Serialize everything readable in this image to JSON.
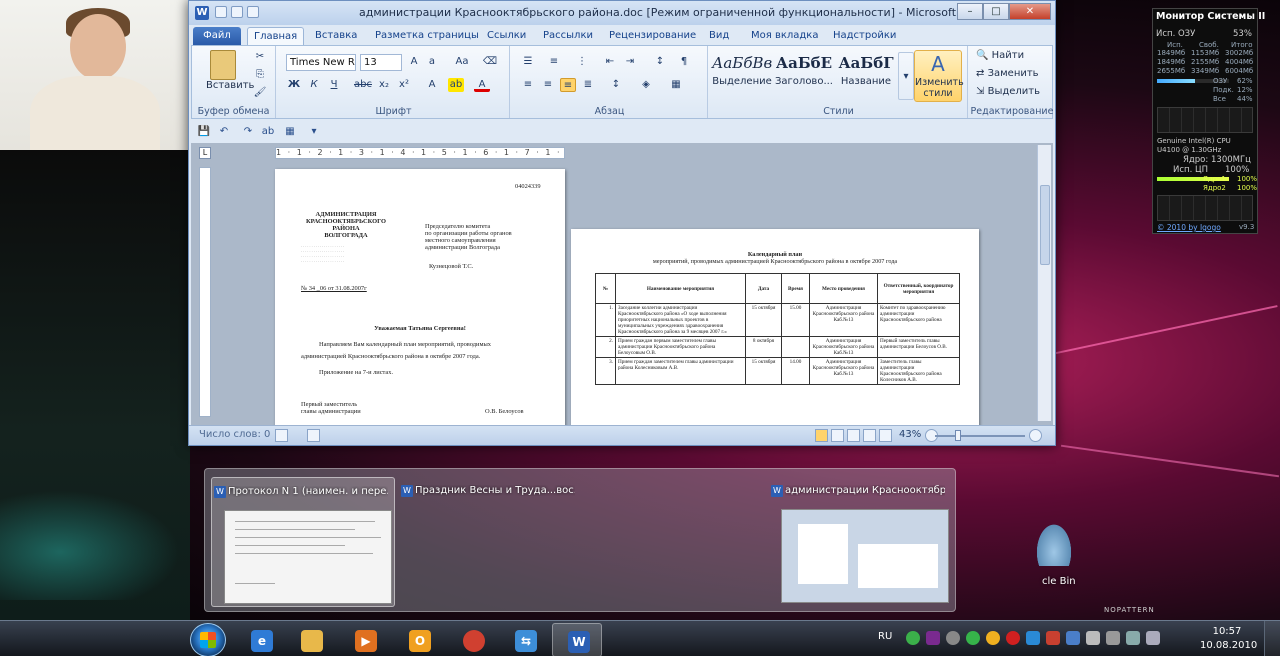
{
  "word": {
    "title": "администрации Красноoктябрьского района.doc [Режим ограниченной функциональности] - Microsoft Word",
    "tabs": [
      "Файл",
      "Главная",
      "Вставка",
      "Разметка страницы",
      "Ссылки",
      "Рассылки",
      "Рецензирование",
      "Вид",
      "Моя вкладка",
      "Надстройки"
    ],
    "ribbon": {
      "paste_label": "Вставить",
      "clipboard_group": "Буфер обмена",
      "font_group": "Шрифт",
      "paragraph_group": "Абзац",
      "styles_group": "Стили",
      "editing_group": "Редактирование",
      "font_name": "Times New Rc",
      "font_size": "13",
      "styles": [
        {
          "sample": "АаБбВв",
          "name": "Выделение"
        },
        {
          "sample": "АаБбЕ",
          "name": "Заголово..."
        },
        {
          "sample": "АаБбГ",
          "name": "Название"
        }
      ],
      "change_styles": "Изменить стили",
      "find": "Найти",
      "replace": "Заменить",
      "select": "Выделить"
    },
    "status": {
      "word_count": "Число слов: 0",
      "zoom": "43%"
    },
    "ruler_marks": "1 · 1 · 2 · 1 · 3 · 1 · 4 · 1 · 5 · 1 · 6 · 1 · 7 · 1 · 8 · 1 · 9 · 1 ·10· 1 ·11· 1 ·12· 1 ·13· 1 ·14· 1 ·15· 1 ·16· 1 ·17· 1 ·18·",
    "page1": {
      "doc_number": "04024339",
      "org": [
        "АДМИНИСТРАЦИЯ",
        "КРАСНООКТЯБРЬСКОГО",
        "РАЙОНА",
        "ВОЛГОГРАДА"
      ],
      "addressee": [
        "Председателю комитета",
        "по организации работы органов",
        "местного самоуправления",
        "администрации Волгограда"
      ],
      "addressee_name": "Кузнецовой Т.С.",
      "out_number": "№ 34 _06 от 31.08.2007г",
      "greeting": "Уважаемая Татьяна Сергеевна!",
      "body1": "Направляем Вам календарный план мероприятий, проводимых",
      "body2": "администрацией Краснооктябрьского района в октябре 2007 года.",
      "attachment": "Приложение на 7-и листах.",
      "signer1": "Первый заместитель",
      "signer2": "главы администрации",
      "signer_name": "О.В. Белоусов"
    },
    "page2": {
      "title": "Календарный план",
      "subtitle": "мероприятий, проводимых администрацией Краснооктябрьского района в октябре 2007 года",
      "headers": [
        "№",
        "Наименование мероприятия",
        "Дата",
        "Время",
        "Место проведения",
        "Ответственный, координатор мероприятия"
      ],
      "rows": [
        [
          "1.",
          "Заседание коллегии администрации Краснооктябрьского района «О ходе выполнения приоритетных национальных проектов в муниципальных учреждениях здравоохранения Краснооктябрьского района за 9 месяцев 2007 г.»",
          "15 октября",
          "15.00",
          "Администрация Краснооктябрьского района Каб.№13",
          "Комитет по здравоохранению администрации Краснооктябрьского района"
        ],
        [
          "2.",
          "Прием граждан первым заместителем главы администрации Краснооктябрьского района Белоусовым О.В.",
          "8 октября",
          "",
          "Администрация Краснооктябрьского района Каб.№13",
          "Первый заместитель главы администрации Белоусов О.В."
        ],
        [
          "3.",
          "Прием граждан заместителем главы администрации района Колесниковым А.В.",
          "15 октября",
          "14.00",
          "Администрация Краснооктябрьского района Каб.№13",
          "Заместитель главы администрации Краснооктябрьского района Колесников А.В."
        ]
      ]
    }
  },
  "gadget": {
    "title": "Монитор Системы II",
    "ram_label": "Исп. ОЗУ",
    "ram_percent": "53%",
    "mem_cols": [
      "Исп.",
      "Своб.",
      "Итого"
    ],
    "mem_rows": [
      [
        "1849Мб",
        "1153Мб",
        "3002Мб"
      ],
      [
        "1849Мб",
        "2155Мб",
        "4004Мб"
      ],
      [
        "2655Мб",
        "3349Мб",
        "6004Мб"
      ]
    ],
    "swap_labels": [
      "ОЗУ",
      "Подк.",
      "Все"
    ],
    "swap_values": [
      "62%",
      "12%",
      "44%"
    ],
    "ram_fill": 0.53,
    "cpu_name": "Genuine Intel(R) CPU",
    "cpu_model": "U4100 @ 1.30GHz",
    "core_label": "Ядро:",
    "core_freq": "1300МГц",
    "cpu_label": "Исп. ЦП",
    "cpu_percent": "100%",
    "cpu_fill": 1.0,
    "cores": [
      {
        "name": "Ядро1",
        "value": "100%"
      },
      {
        "name": "Ядро2",
        "value": "100%"
      }
    ],
    "copyright": "© 2010 by Igogo",
    "version": "v9.3"
  },
  "peek": {
    "thumbs": [
      {
        "label": "Протокол N 1 (наимен. и пере..."
      },
      {
        "label": "Праздник Весны и Труда...вос..."
      },
      {
        "label": "администрации Краснооктябр..."
      }
    ]
  },
  "desktop": {
    "recycle_label": "cle Bin",
    "watermark": "NOPATTERN"
  },
  "taskbar": {
    "lang": "RU",
    "time": "10:57",
    "date": "10.08.2010",
    "apps": [
      {
        "name": "internet-explorer",
        "glyph": "e",
        "color": "#2f7bd6"
      },
      {
        "name": "file-explorer",
        "glyph": "",
        "color": "#e8b84a"
      },
      {
        "name": "media-player",
        "glyph": "▶",
        "color": "#e07020"
      },
      {
        "name": "outlook",
        "glyph": "O",
        "color": "#f0a020"
      },
      {
        "name": "chrome",
        "glyph": "",
        "color": "#d04030"
      },
      {
        "name": "switcher",
        "glyph": "⇆",
        "color": "#3d8ed8"
      },
      {
        "name": "word",
        "glyph": "W",
        "color": "#2b5fb4"
      }
    ]
  }
}
